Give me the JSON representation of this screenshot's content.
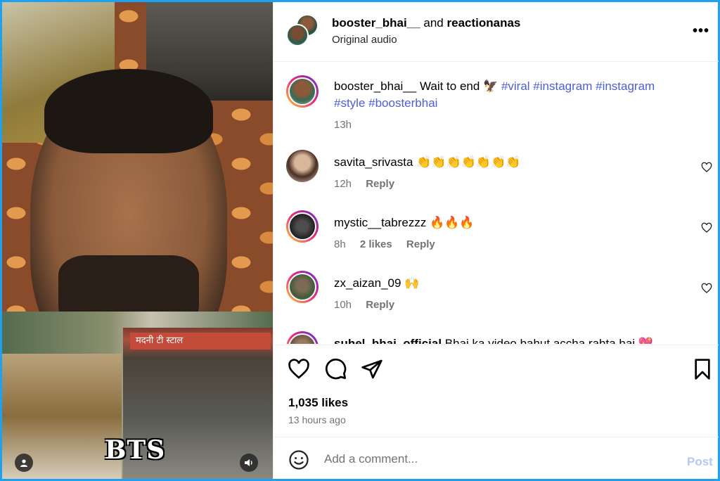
{
  "media": {
    "bts_text": "BTS",
    "shop_sign": "मदनी टी स्टाल",
    "user_tag_icon": "person-icon",
    "audio_icon": "speaker-icon"
  },
  "header": {
    "user1": "booster_bhai__",
    "and_text": "and",
    "user2": "reactionanas",
    "subtitle": "Original audio",
    "more": "•••"
  },
  "caption": {
    "username": "booster_bhai__",
    "text": "Wait to end",
    "tags": "#viral #instagram #instagram",
    "tags2": "#style #boosterbhai",
    "time": "13h"
  },
  "comments": [
    {
      "username": "savita_srivasta",
      "text": "👏👏👏👏👏👏👏",
      "time": "12h",
      "likes": "",
      "reply": "Reply"
    },
    {
      "username": "mystic__tabrezzz",
      "text": "🔥🔥🔥",
      "time": "8h",
      "likes": "2 likes",
      "reply": "Reply"
    },
    {
      "username": "zx_aizan_09",
      "text": "🙌",
      "time": "10h",
      "likes": "",
      "reply": "Reply"
    },
    {
      "username": "suhel_bhai_official",
      "text": "Bhai ka video bahut accha rahta hai 💖",
      "time": "",
      "likes": "",
      "reply": ""
    }
  ],
  "stats": {
    "likes": "1,035 likes",
    "time_ago": "13 hours ago"
  },
  "composer": {
    "placeholder": "Add a comment...",
    "post": "Post"
  },
  "colors": {
    "link": "#4c5ed8",
    "muted": "#737373",
    "post_disabled": "#b3c8f5",
    "frame": "#1da1f2"
  }
}
